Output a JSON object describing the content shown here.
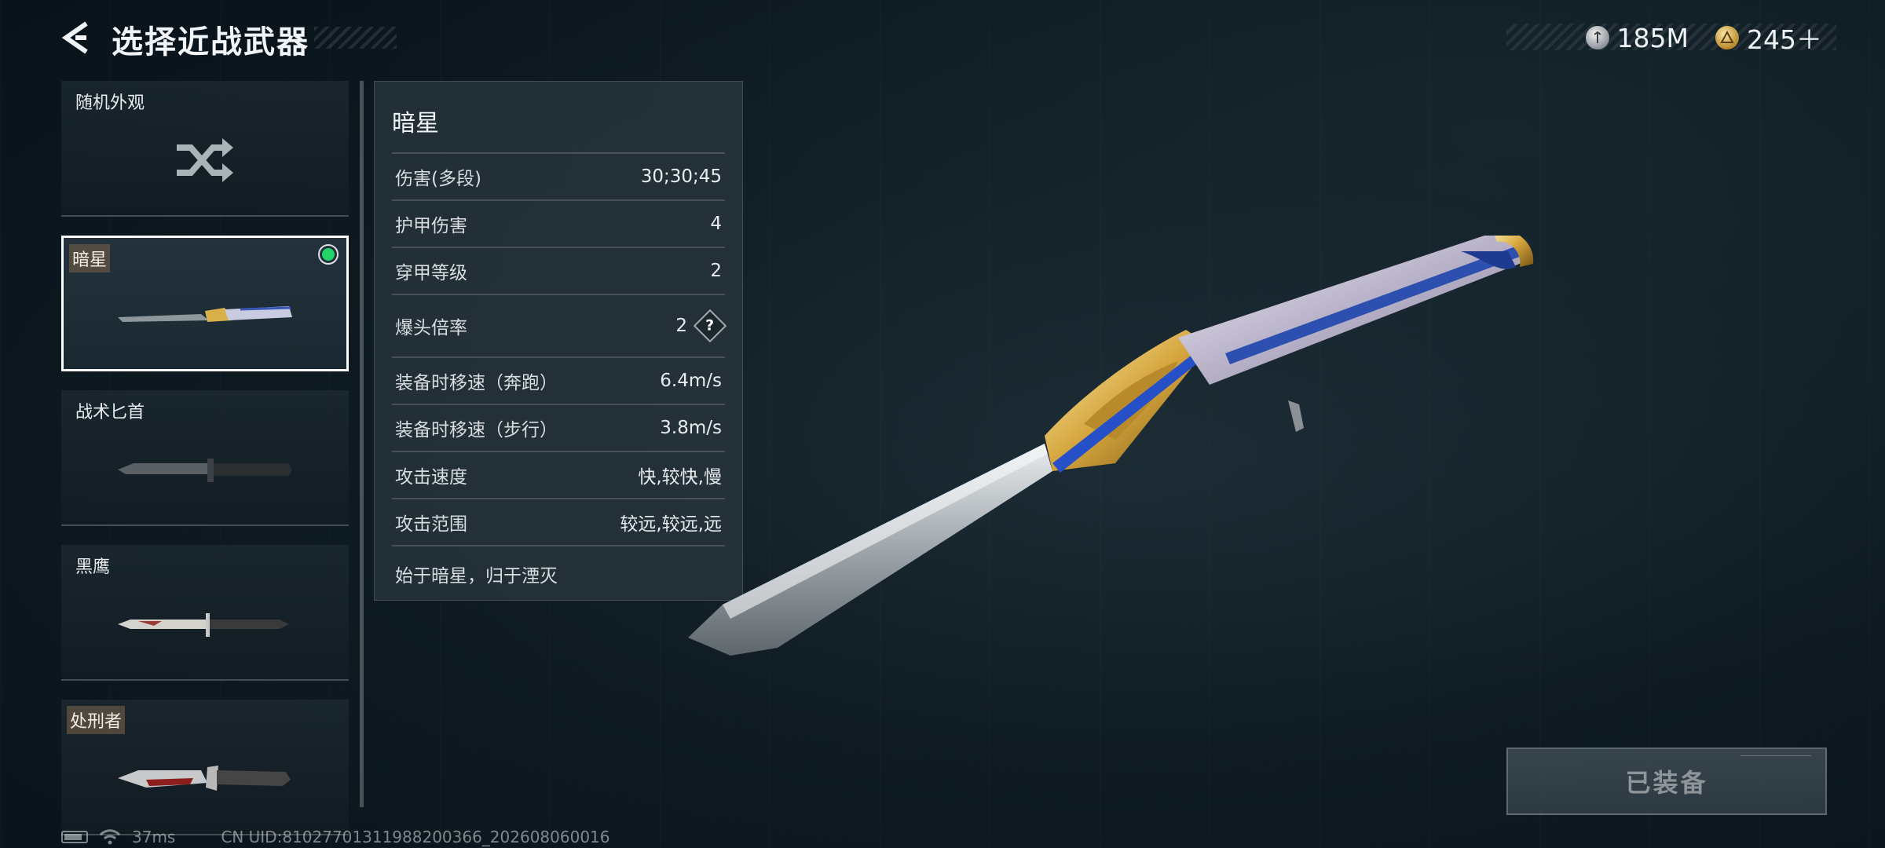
{
  "header": {
    "title": "选择近战武器",
    "currencies": [
      {
        "icon": "silver-coin-icon",
        "amount": "185M"
      },
      {
        "icon": "gold-coin-icon",
        "amount": "245＋"
      }
    ]
  },
  "weapon_list": {
    "random": {
      "label": "随机外观",
      "icon": "shuffle-icon"
    },
    "items": [
      {
        "label": "暗星",
        "tagged": true,
        "selected": true,
        "equipped": true
      },
      {
        "label": "战术匕首",
        "tagged": false
      },
      {
        "label": "黑鹰",
        "tagged": false
      },
      {
        "label": "处刑者",
        "tagged": true
      }
    ]
  },
  "stats": {
    "name": "暗星",
    "rows": [
      {
        "label": "伤害(多段)",
        "value": "30;30;45"
      },
      {
        "label": "护甲伤害",
        "value": "4"
      },
      {
        "label": "穿甲等级",
        "value": "2"
      },
      {
        "label": "爆头倍率",
        "value": "2",
        "help": "?"
      },
      {
        "label": "装备时移速（奔跑）",
        "value": "6.4m/s"
      },
      {
        "label": "装备时移速（步行）",
        "value": "3.8m/s"
      },
      {
        "label": "攻击速度",
        "value": "快,较快,慢"
      },
      {
        "label": "攻击范围",
        "value": "较远,较远,远"
      }
    ],
    "flavor": "始于暗星，归于湮灭"
  },
  "equip_button": {
    "label": "已装备"
  },
  "status": {
    "ping": "37ms",
    "uid": "CN UID:810277013119882003​66_202608060016"
  },
  "colors": {
    "equipped": "#22d36a",
    "selected_border": "#ffffff"
  }
}
